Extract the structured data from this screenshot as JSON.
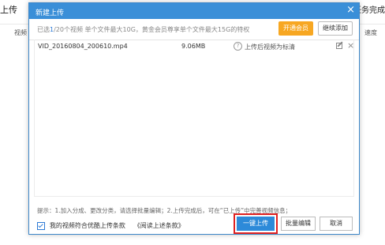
{
  "background": {
    "top_left": "上传",
    "top_right": "任务完成",
    "col_left": "视频",
    "col_right": "速度"
  },
  "dialog": {
    "title": "新建上传",
    "close_glyph": "×",
    "quota": {
      "prefix": "已选",
      "selected": "1",
      "suffix": "/20个视频  单个文件最大10G，黄金会员尊享单个文件最大15G的特权"
    },
    "vip_button": "开通会员",
    "add_button": "继续添加",
    "files": [
      {
        "name": "VID_20160804_200610.mp4",
        "size": "9.06MB",
        "help_glyph": "?",
        "quality": "上传后视频为标清",
        "remove_glyph": "×"
      }
    ],
    "hint": "提示：1.加入分成、更改分类，请选择批量编辑；2.上传完成后，可在“已上传”中完善视频信息；",
    "agree_text": "我的视频符合优酷上传条款",
    "terms_link": "《阅读上述条款》",
    "upload_button": "一键上传",
    "batch_button": "批量编辑",
    "cancel_button": "取消"
  }
}
